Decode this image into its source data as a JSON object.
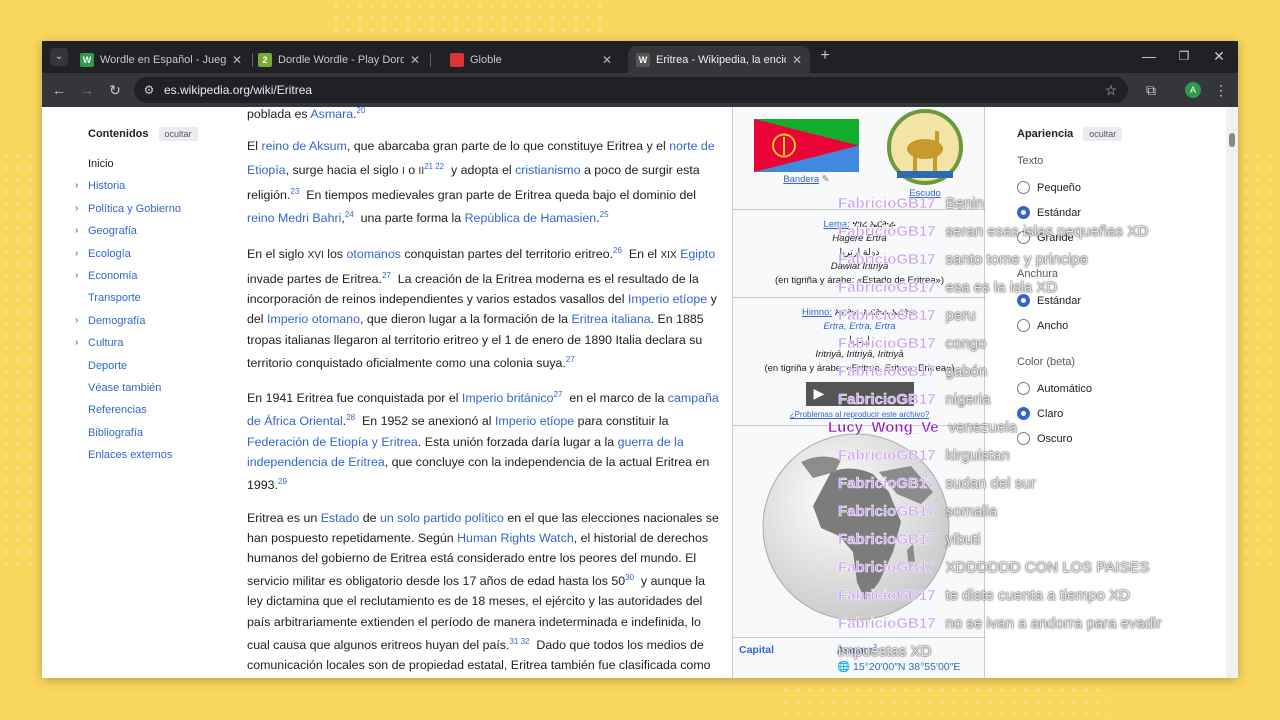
{
  "browser": {
    "tabs": [
      {
        "title": "Wordle en Español - Juega Wor",
        "fav": "W",
        "fav_color": "#2e9a4b"
      },
      {
        "title": "Dordle Wordle - Play Dordle G",
        "fav": "2",
        "fav_color": "#77aa33"
      },
      {
        "title": "Globle",
        "fav": "",
        "fav_color": "#d33"
      },
      {
        "title": "Eritrea - Wikipedia, la enciclope",
        "fav": "W",
        "fav_color": "#555"
      }
    ],
    "url": "es.wikipedia.org/wiki/Eritrea",
    "new_tab": "+",
    "profile": "A"
  },
  "toc": {
    "heading": "Contenidos",
    "hide": "ocultar",
    "items": [
      {
        "label": "Inicio",
        "expand": false
      },
      {
        "label": "Historia",
        "expand": true
      },
      {
        "label": "Política y Gobierno",
        "expand": true
      },
      {
        "label": "Geografía",
        "expand": true
      },
      {
        "label": "Ecología",
        "expand": true
      },
      {
        "label": "Economía",
        "expand": true
      },
      {
        "label": "Transporte",
        "expand": false
      },
      {
        "label": "Demografía",
        "expand": true
      },
      {
        "label": "Cultura",
        "expand": true
      },
      {
        "label": "Deporte",
        "expand": false
      },
      {
        "label": "Véase también",
        "expand": false
      },
      {
        "label": "Referencias",
        "expand": false
      },
      {
        "label": "Bibliografía",
        "expand": false
      },
      {
        "label": "Enlaces externos",
        "expand": false
      }
    ]
  },
  "article": {
    "p0": "poblada es Asmara.",
    "p0_ref": "20"
  },
  "infobox": {
    "flag_caption": "Bandera",
    "coat_caption": "Escudo",
    "lema_label": "Lema:",
    "lema_native": "ሃገረ ኤርትራ",
    "lema_latin": "Hagere Ertra",
    "lema_ar": "دولة إرتريا",
    "lema_latin2": "Dawlat Iritriyā",
    "lema_note": "(en tigriña y árabe: «Estado de Eritrea»)",
    "himno_label": "Himno:",
    "himno_native": "ኤርትራ ኤርትራ ኤርትራ",
    "himno_latin": "Ertra, Ertra, Ertra",
    "himno_ar": "إرتريا",
    "himno_latin2": "Iritriyā, Iritriyā, Iritriyā",
    "himno_note": "(en tigriña y árabe: «Eritrea, Eritrea, Eritrea»)",
    "audio_help": "¿Problemas al reproducir este archivo?",
    "capital_label": "Capital",
    "capital_value": "Asmara",
    "capital_ref": "2",
    "capital_coords": "15°20′00″N 38°55′00″E"
  },
  "appearance": {
    "heading": "Apariencia",
    "hide": "ocultar",
    "groups": [
      {
        "label": "Texto",
        "options": [
          {
            "label": "Pequeño",
            "on": false
          },
          {
            "label": "Estándar",
            "on": true
          },
          {
            "label": "Grande",
            "on": false
          }
        ]
      },
      {
        "label": "Anchura",
        "options": [
          {
            "label": "Estándar",
            "on": true
          },
          {
            "label": "Ancho",
            "on": false
          }
        ]
      },
      {
        "label": "Color (beta)",
        "options": [
          {
            "label": "Automático",
            "on": false
          },
          {
            "label": "Claro",
            "on": true
          },
          {
            "label": "Oscuro",
            "on": false
          }
        ]
      }
    ]
  },
  "chat": [
    {
      "user": "FabricioGB17",
      "msg": "Benin"
    },
    {
      "user": "FabricioGB17",
      "msg": "seran esas islas pequeñas XD"
    },
    {
      "user": "FabricioGB17",
      "msg": "santo tome y principe"
    },
    {
      "user": "FabricioGB17",
      "msg": "esa es la isla XD"
    },
    {
      "user": "FabricioGB17",
      "msg": "peru"
    },
    {
      "user": "FabricioGB17",
      "msg": "congo"
    },
    {
      "user": "FabricioGB17",
      "msg": "gabón"
    },
    {
      "user": "FabricioGB17",
      "msg": "nigeria"
    },
    {
      "user": "Lucy_Wong_Ve",
      "msg": "venezuela"
    },
    {
      "user": "FabricioGB17",
      "msg": "kirguistan"
    },
    {
      "user": "FabricioGB17",
      "msg": "sudan del sur"
    },
    {
      "user": "FabricioGB17",
      "msg": "somalia"
    },
    {
      "user": "FabricioGB17",
      "msg": "yibuti"
    },
    {
      "user": "FabricioGB17",
      "msg": "XDDDDDD CON LOS PAISES"
    },
    {
      "user": "FabricioGB17",
      "msg": "te diste cuenta a tiempo XD"
    },
    {
      "user": "FabricioGB17",
      "msg": "no se ivan a andorra para evadir"
    },
    {
      "user": "",
      "msg": "impuestas XD"
    }
  ]
}
